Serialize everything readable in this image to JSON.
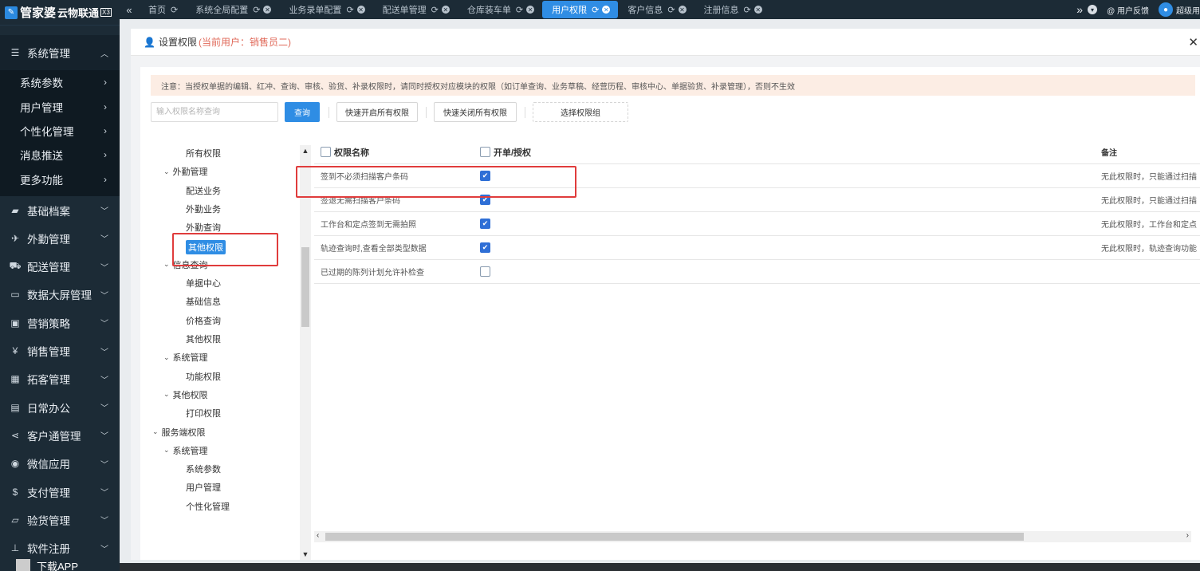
{
  "app": {
    "logo_text": "管家婆",
    "logo_sub": "云物联通",
    "logo_version": "X3"
  },
  "sidebar": {
    "sections": [
      {
        "label": "系统管理",
        "icon": "sliders-icon",
        "expanded": true
      },
      {
        "label": "基础档案",
        "icon": "folder-icon"
      },
      {
        "label": "外勤管理",
        "icon": "plane-icon"
      },
      {
        "label": "配送管理",
        "icon": "truck-icon"
      },
      {
        "label": "数据大屏管理",
        "icon": "monitor-icon"
      },
      {
        "label": "营销策略",
        "icon": "image-icon"
      },
      {
        "label": "销售管理",
        "icon": "yen-icon"
      },
      {
        "label": "拓客管理",
        "icon": "grid-icon"
      },
      {
        "label": "日常办公",
        "icon": "briefcase-icon"
      },
      {
        "label": "客户通管理",
        "icon": "share-icon"
      },
      {
        "label": "微信应用",
        "icon": "wechat-icon"
      },
      {
        "label": "支付管理",
        "icon": "dollar-icon"
      },
      {
        "label": "验货管理",
        "icon": "inbox-icon"
      },
      {
        "label": "软件注册",
        "icon": "sitemap-icon"
      }
    ],
    "sub_items": [
      "系统参数",
      "用户管理",
      "个性化管理",
      "消息推送",
      "更多功能"
    ],
    "download_label": "下载APP"
  },
  "tabs": {
    "items": [
      {
        "label": "首页",
        "active": false
      },
      {
        "label": "系统全局配置",
        "active": false
      },
      {
        "label": "业务录单配置",
        "active": false
      },
      {
        "label": "配送单管理",
        "active": false
      },
      {
        "label": "仓库装车单",
        "active": false
      },
      {
        "label": "用户权限",
        "active": true
      },
      {
        "label": "客户信息",
        "active": false
      },
      {
        "label": "注册信息",
        "active": false
      }
    ],
    "feedback_label": "@ 用户反馈",
    "user_label": "超级用"
  },
  "panel": {
    "title": "设置权限",
    "current_user": "(当前用户：销售员二)",
    "notice": "注意：当授权单据的编辑、红冲、查询、审核、验货、补录权限时，请同时授权对应模块的权限（如订单查询、业务草稿、经营历程、审核中心、单据验货、补录管理），否则不生效",
    "search_placeholder": "输入权限名称查询",
    "btn_query": "查询",
    "btn_open_all": "快速开启所有权限",
    "btn_close_all": "快速关闭所有权限",
    "btn_select_group": "选择权限组"
  },
  "tree": {
    "nodes": [
      {
        "label": "所有权限",
        "level": 3
      },
      {
        "label": "外勤管理",
        "level": 2,
        "caret": true
      },
      {
        "label": "配送业务",
        "level": 3
      },
      {
        "label": "外勤业务",
        "level": 3
      },
      {
        "label": "外勤查询",
        "level": 3
      },
      {
        "label": "其他权限",
        "level": 3,
        "selected": true
      },
      {
        "label": "信息查询",
        "level": 2,
        "caret": true
      },
      {
        "label": "单据中心",
        "level": 3
      },
      {
        "label": "基础信息",
        "level": 3
      },
      {
        "label": "价格查询",
        "level": 3
      },
      {
        "label": "其他权限",
        "level": 3
      },
      {
        "label": "系统管理",
        "level": 2,
        "caret": true
      },
      {
        "label": "功能权限",
        "level": 3
      },
      {
        "label": "其他权限",
        "level": 2,
        "caret": true
      },
      {
        "label": "打印权限",
        "level": 3
      },
      {
        "label": "服务端权限",
        "level": 1,
        "caret": true
      },
      {
        "label": "系统管理",
        "level": 2,
        "caret": true
      },
      {
        "label": "系统参数",
        "level": 3
      },
      {
        "label": "用户管理",
        "level": 3
      },
      {
        "label": "个性化管理",
        "level": 3
      }
    ]
  },
  "table": {
    "headers": {
      "name": "权限名称",
      "auth": "开单/授权",
      "remark": "备注"
    },
    "rows": [
      {
        "name": "签到不必须扫描客户条码",
        "checked": true,
        "remark": "无此权限时，只能通过扫描"
      },
      {
        "name": "签退无需扫描客户条码",
        "checked": true,
        "remark": "无此权限时，只能通过扫描"
      },
      {
        "name": "工作台和定点签到无需拍照",
        "checked": true,
        "remark": "无此权限时，工作台和定点"
      },
      {
        "name": "轨迹查询时,查看全部类型数据",
        "checked": true,
        "remark": "无此权限时，轨迹查询功能"
      },
      {
        "name": "已过期的陈列计划允许补检查",
        "checked": false,
        "remark": ""
      }
    ]
  },
  "colors": {
    "accent": "#2f8de4",
    "sidebar_bg": "#1c2b36",
    "annotation_red": "#e03c3c",
    "notice_bg": "#fcede4"
  }
}
